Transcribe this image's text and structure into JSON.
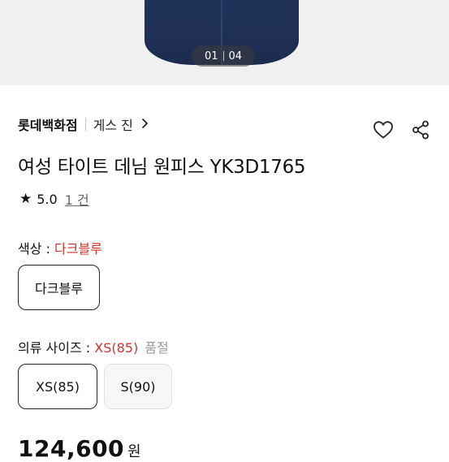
{
  "gallery": {
    "current": "01",
    "total": "04"
  },
  "breadcrumb": {
    "brand": "롯데백화점",
    "category": "게스 진"
  },
  "product": {
    "title": "여성 타이트 데님 원피스 YK3D1765",
    "rating": "5.0",
    "review_count": "1 건"
  },
  "color_option": {
    "label": "색상 : ",
    "selected": "다크블루",
    "choices": [
      "다크블루"
    ]
  },
  "size_option": {
    "label": "의류 사이즈 : ",
    "selected": "XS(85)",
    "status": "품절",
    "choices": [
      "XS(85)",
      "S(90)"
    ]
  },
  "price": {
    "amount": "124,600",
    "unit": "원"
  },
  "icons": [
    "star-icon",
    "heart-icon",
    "share-icon",
    "chevron-right-icon"
  ]
}
